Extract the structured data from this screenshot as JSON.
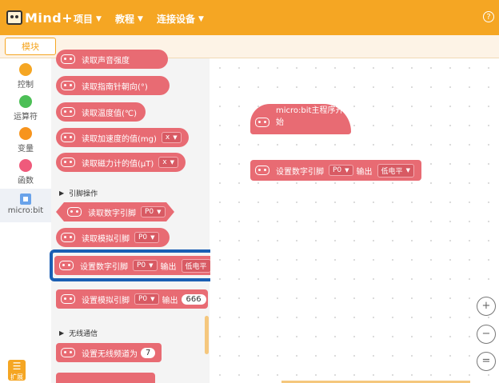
{
  "app": {
    "logo_text": "Mind+"
  },
  "menu": [
    {
      "label": "项目"
    },
    {
      "label": "教程"
    },
    {
      "label": "连接设备"
    }
  ],
  "help_icon": "?",
  "tab": {
    "label": "模块"
  },
  "categories": [
    {
      "label": "控制",
      "color": "#F5A623"
    },
    {
      "label": "运算符",
      "color": "#4CBF56"
    },
    {
      "label": "变量",
      "color": "#F7941D"
    },
    {
      "label": "函数",
      "color": "#EF5A7B"
    },
    {
      "label": "micro:bit",
      "color": "#6AA3EA"
    }
  ],
  "extension_button": {
    "label": "扩展"
  },
  "flyout": {
    "blocks": [
      {
        "label": "读取声音强度"
      },
      {
        "label": "读取指南针朝向(°)"
      },
      {
        "label": "读取温度值(℃)"
      },
      {
        "label": "读取加速度的值(mg)",
        "dropdown": "x"
      },
      {
        "label": "读取磁力计的值(µT)",
        "dropdown": "x"
      }
    ],
    "section_pins": "引脚操作",
    "pin_blocks": {
      "read_digital": {
        "label": "读取数字引脚",
        "pin": "P0"
      },
      "read_analog": {
        "label": "读取模拟引脚",
        "pin": "P0"
      },
      "set_digital": {
        "label": "设置数字引脚",
        "pin": "P0",
        "output": "输出",
        "level": "低电平"
      },
      "set_analog": {
        "label": "设置模拟引脚",
        "pin": "P0",
        "output": "输出",
        "value": "666"
      }
    },
    "section_radio": "无线通信",
    "radio_blocks": {
      "set_channel": {
        "label": "设置无线频道为",
        "value": "7"
      }
    }
  },
  "workspace": {
    "hat_block": {
      "label": "micro:bit主程序开始"
    },
    "stack_block": {
      "label": "设置数字引脚",
      "pin": "P0",
      "output": "输出",
      "level": "低电平"
    }
  },
  "zoom_controls": {
    "zoom_in": "+",
    "zoom_out": "−",
    "reset": "="
  },
  "colors": {
    "accent": "#F5A623",
    "block": "#E86B73",
    "highlight": "#1A5FB4"
  }
}
